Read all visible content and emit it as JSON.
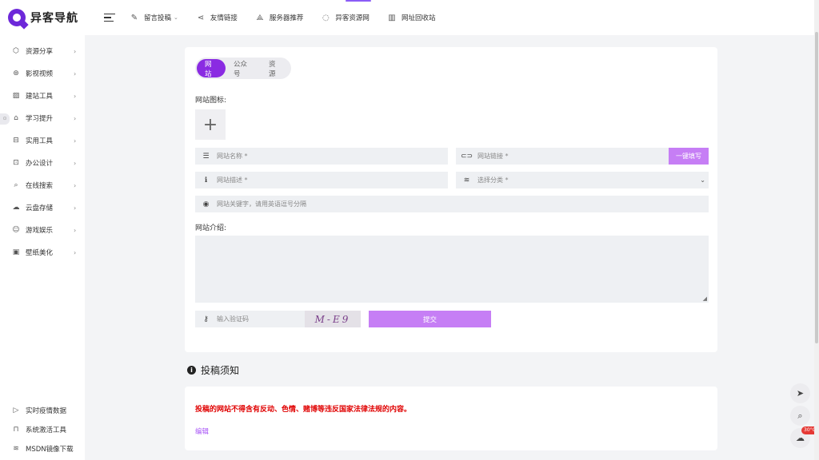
{
  "header": {
    "logo_text": "异客导航",
    "nav": [
      {
        "icon": "message-edit-icon",
        "label": "留言投稿",
        "has_caret": true
      },
      {
        "icon": "share-icon",
        "label": "友情链接"
      },
      {
        "icon": "server-icon",
        "label": "服务器推荐"
      },
      {
        "icon": "globe-icon",
        "label": "异客资源网"
      },
      {
        "icon": "trash-icon",
        "label": "网址回收站"
      }
    ]
  },
  "sidebar": {
    "items": [
      {
        "icon": "cube-icon",
        "label": "资源分享"
      },
      {
        "icon": "film-icon",
        "label": "影视视频"
      },
      {
        "icon": "chart-icon",
        "label": "建站工具"
      },
      {
        "icon": "graduation-icon",
        "label": "学习提升"
      },
      {
        "icon": "toolbox-icon",
        "label": "实用工具"
      },
      {
        "icon": "briefcase-icon",
        "label": "办公设计"
      },
      {
        "icon": "search-icon",
        "label": "在线搜索"
      },
      {
        "icon": "cloud-icon",
        "label": "云盘存储"
      },
      {
        "icon": "smile-icon",
        "label": "游戏娱乐"
      },
      {
        "icon": "image-icon",
        "label": "壁纸美化"
      }
    ],
    "bottom_items": [
      {
        "icon": "play-circle-icon",
        "label": "实时疫情数据"
      },
      {
        "icon": "lock-icon",
        "label": "系统激活工具"
      },
      {
        "icon": "layers-icon",
        "label": "MSDN镜像下载"
      }
    ]
  },
  "form": {
    "tabs": [
      "网站",
      "公众号",
      "资源"
    ],
    "active_tab": 0,
    "icon_label": "网站图标:",
    "name_placeholder": "网站名称 *",
    "url_placeholder": "网站链接 *",
    "autofill_button": "一键填写",
    "desc_placeholder": "网站描述 *",
    "category_placeholder": "选择分类 *",
    "keywords_placeholder": "网站关键字，请用英语逗号分隔",
    "intro_label": "网站介绍:",
    "captcha_placeholder": "输入验证码",
    "captcha_image_text": "M-E9",
    "submit_button": "提交"
  },
  "notice": {
    "title": "投稿须知",
    "text": "投稿的网站不得含有反动、色情、赌博等违反国家法律法规的内容。",
    "edit_link": "编辑"
  },
  "floating": {
    "weather_temp": "30°C"
  },
  "colors": {
    "accent": "#8a2be2",
    "button": "#c67ef5",
    "warning": "#e00000",
    "link": "#a855f7"
  }
}
